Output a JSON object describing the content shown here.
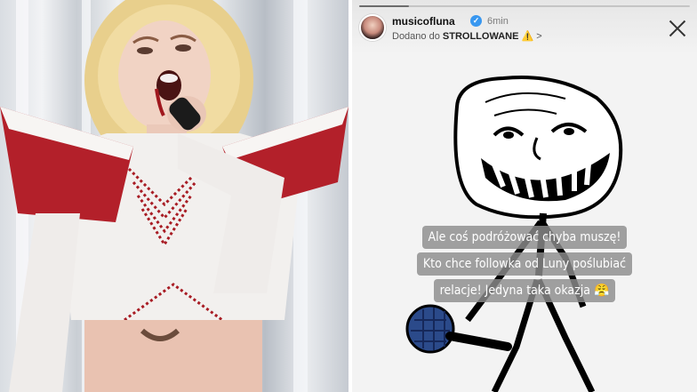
{
  "story": {
    "username": "musicofluna",
    "verified_glyph": "✓",
    "timestamp": "6min",
    "added_to_prefix": "Dodano do",
    "collection_name": "STROLLOWANE",
    "collection_suffix": "⚠️ >",
    "close_icon": "close-icon",
    "progress": 0.15,
    "caption_lines": [
      "Ale coś podróżować chyba muszę!",
      "Kto chce followka od Luny poślubiać",
      "relacje! Jedyna taka okazja 😤"
    ]
  },
  "colors": {
    "costume_red": "#b3202a",
    "costume_white": "#f2f0ee",
    "verified_blue": "#3897f0"
  }
}
